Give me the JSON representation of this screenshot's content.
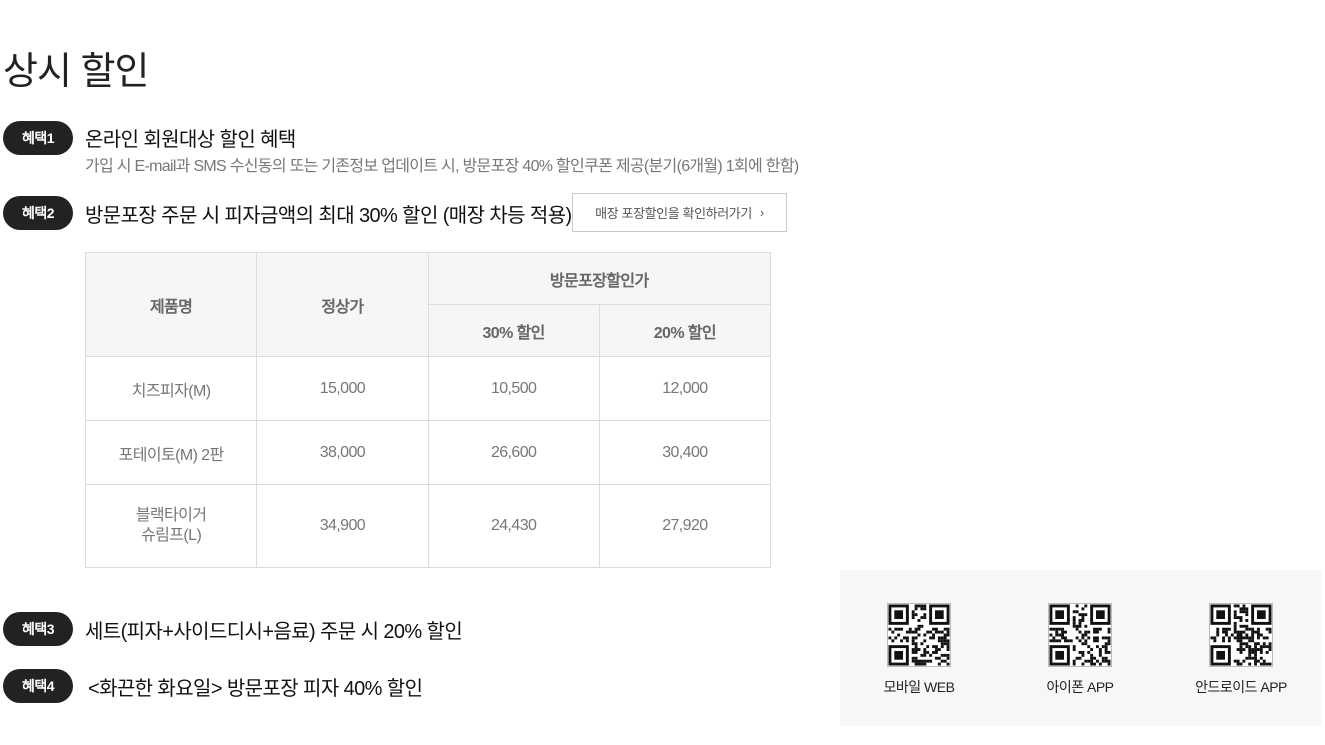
{
  "page_title": "상시 할인",
  "benefits": [
    {
      "badge": "혜택1",
      "title": "온라인 회원대상 할인 혜택",
      "description": "가입 시 E-mail과 SMS 수신동의 또는 기존정보 업데이트 시, 방문포장 40% 할인쿠폰 제공(분기(6개월) 1회에 한함)"
    },
    {
      "badge": "혜택2",
      "title": "방문포장 주문 시 피자금액의 최대 30% 할인 (매장 차등 적용)",
      "button_label": "매장 포장할인을 확인하러가기"
    },
    {
      "badge": "혜택3",
      "title": "세트(피자+사이드디시+음료) 주문 시 20% 할인"
    },
    {
      "badge": "혜택4",
      "title": "<화끈한 화요일> 방문포장 피자 40% 할인"
    }
  ],
  "price_table": {
    "headers": {
      "product": "제품명",
      "regular": "정상가",
      "takeout_group": "방문포장할인가",
      "discount_30": "30% 할인",
      "discount_20": "20% 할인"
    },
    "rows": [
      {
        "product_line1": "치즈피자(M)",
        "product_line2": "",
        "regular": "15,000",
        "d30": "10,500",
        "d20": "12,000"
      },
      {
        "product_line1": "포테이토(M) 2판",
        "product_line2": "",
        "regular": "38,000",
        "d30": "26,600",
        "d20": "30,400"
      },
      {
        "product_line1": "블랙타이거",
        "product_line2": "슈림프(L)",
        "regular": "34,900",
        "d30": "24,430",
        "d20": "27,920"
      }
    ]
  },
  "qr_codes": [
    {
      "label": "모바일 WEB",
      "icon": "qr-code-icon"
    },
    {
      "label": "아이폰 APP",
      "icon": "qr-code-icon"
    },
    {
      "label": "안드로이드 APP",
      "icon": "qr-code-icon"
    }
  ],
  "colors": {
    "badge_bg": "#222222",
    "table_header_bg": "#f6f6f6",
    "qr_panel_bg": "#f7f7f7"
  }
}
